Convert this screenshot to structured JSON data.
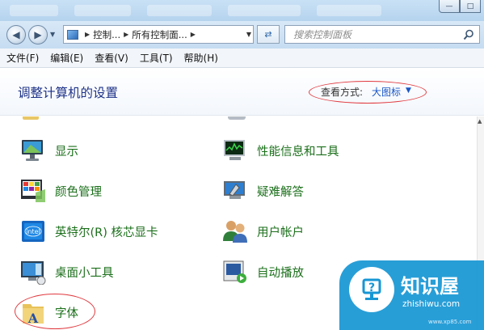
{
  "window": {
    "controls": {
      "minimize": "—",
      "maximize": "□"
    }
  },
  "nav": {
    "back_icon": "back-arrow-icon",
    "forward_icon": "forward-arrow-icon",
    "address_crumbs": [
      "控制...",
      "所有控制面..."
    ],
    "search_placeholder": "搜索控制面板"
  },
  "menubar": {
    "items": [
      "文件(F)",
      "编辑(E)",
      "查看(V)",
      "工具(T)",
      "帮助(H)"
    ]
  },
  "header": {
    "title": "调整计算机的设置",
    "view_by_label": "查看方式:",
    "view_by_value": "大图标"
  },
  "items": [
    {
      "label": "显示",
      "icon": "display-monitor-icon"
    },
    {
      "label": "性能信息和工具",
      "icon": "performance-chart-icon"
    },
    {
      "label": "颜色管理",
      "icon": "color-management-icon"
    },
    {
      "label": "疑难解答",
      "icon": "troubleshooting-icon"
    },
    {
      "label": "英特尔(R) 核芯显卡",
      "icon": "intel-graphics-icon"
    },
    {
      "label": "用户帐户",
      "icon": "user-accounts-icon"
    },
    {
      "label": "桌面小工具",
      "icon": "desktop-gadgets-icon"
    },
    {
      "label": "自动播放",
      "icon": "autoplay-icon"
    },
    {
      "label": "字体",
      "icon": "fonts-folder-icon"
    }
  ],
  "watermark": {
    "title": "知识屋",
    "subtitle": "zhishiwu.com",
    "url": "www.xp85.com"
  }
}
